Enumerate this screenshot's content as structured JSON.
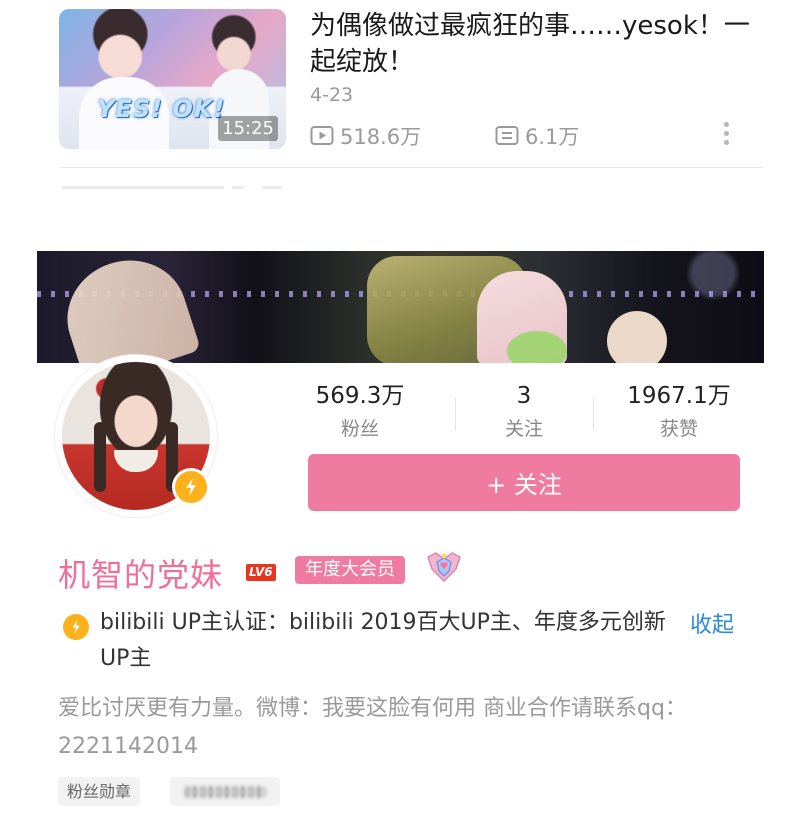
{
  "video": {
    "title": "为偶像做过最疯狂的事……yesok！一起绽放！",
    "watermark": "YES! OK!",
    "duration": "15:25",
    "date": "4-23",
    "plays": "518.6万",
    "comments": "6.1万",
    "icons": {
      "play": "play-count-icon",
      "comment": "comment-count-icon",
      "more": "more-vertical-icon"
    }
  },
  "profile": {
    "fans_count": "569.3万",
    "fans_label": "粉丝",
    "following_count": "3",
    "following_label": "关注",
    "likes_count": "1967.1万",
    "likes_label": "获赞",
    "follow_button": "+ 关注",
    "username": "机智的党妹",
    "level": "LV6",
    "vip": "年度大会员",
    "certification": "bilibili  UP主认证：bilibili  2019百大UP主、年度多元创新UP主",
    "collapse": "收起",
    "signature": "爱比讨厌更有力量。微博：我要这脸有何用  商业合作请联系qq：2221142014",
    "tags": [
      "粉丝勋章"
    ]
  },
  "colors": {
    "accent_pink": "#f07ba1",
    "username_pink": "#f06f99",
    "link_blue": "#2d8bd0",
    "verify_gold": "#ffb11b",
    "level_red": "#e8351f"
  }
}
